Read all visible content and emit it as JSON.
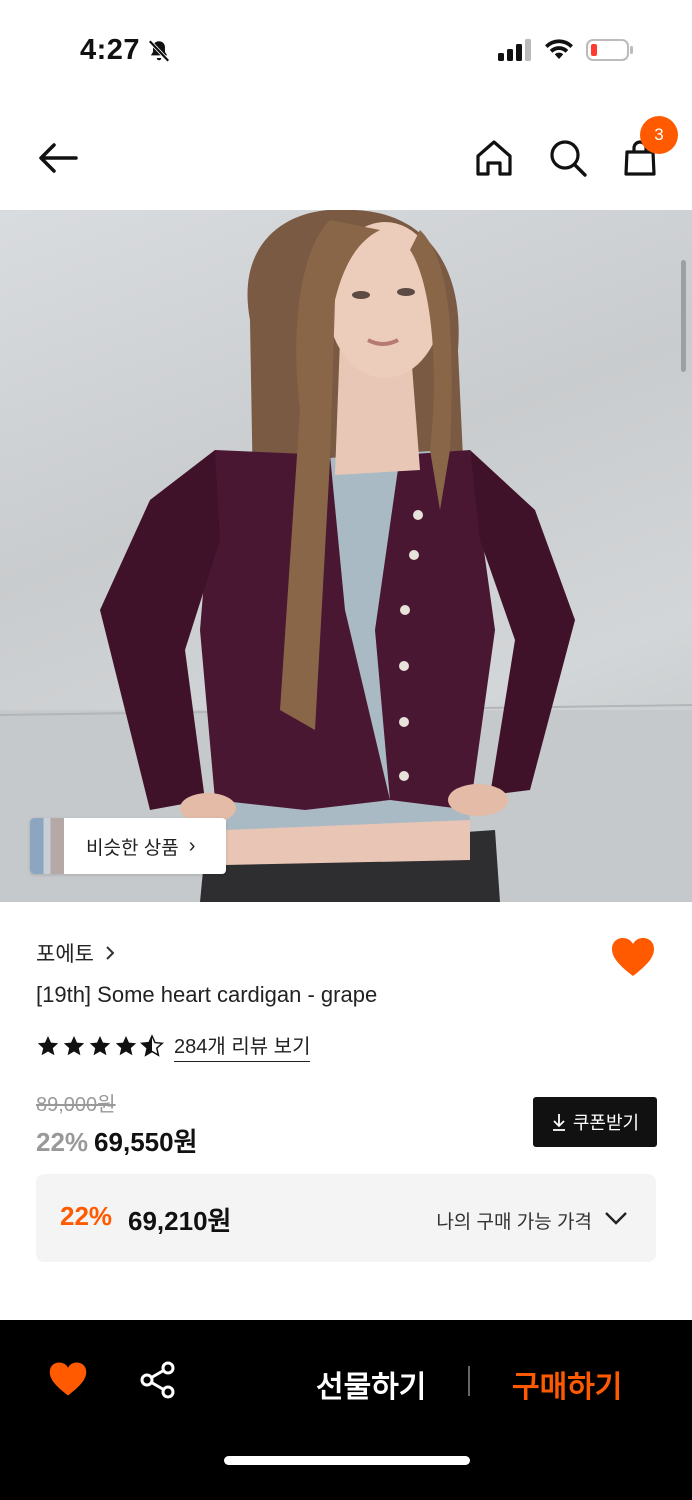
{
  "status": {
    "time": "4:27"
  },
  "nav": {
    "cart_count": "3"
  },
  "image": {
    "similar_label": "비슷한 상품"
  },
  "product": {
    "brand": "포에토",
    "name": "[19th] Some heart cardigan - grape",
    "rating": 4.5,
    "review_link": "284개 리뷰 보기",
    "original_price": "89,000원",
    "discount": "22%",
    "sale_price": "69,550원",
    "coupon_label": "쿠폰받기"
  },
  "my_price": {
    "discount": "22%",
    "price": "69,210원",
    "label": "나의 구매 가능 가격"
  },
  "bottom": {
    "gift_label": "선물하기",
    "buy_label": "구매하기"
  },
  "colors": {
    "accent": "#ff5a00",
    "dark": "#000000"
  }
}
